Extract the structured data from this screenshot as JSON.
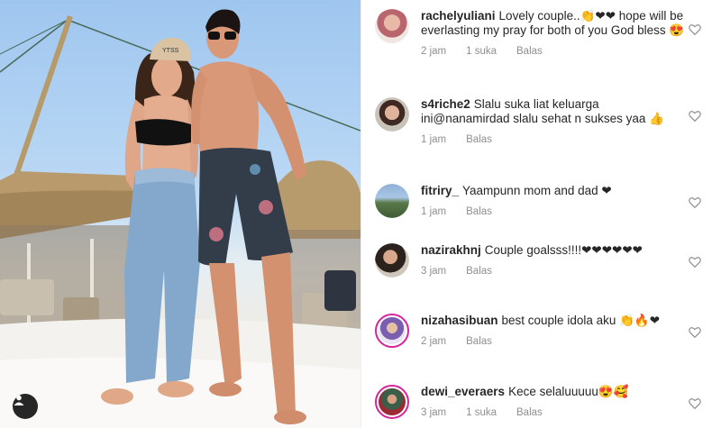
{
  "post": {
    "cap_text": "YTSS"
  },
  "comments": [
    {
      "username": "rachelyuliani",
      "text": "Lovely couple..👏❤❤ hope will be everlasting  my pray for both of you  God bless 😍",
      "time": "2 jam",
      "likes": "1 suka",
      "reply": "Balas"
    },
    {
      "username": "s4riche2",
      "text": "Slalu suka liat keluarga ini@nanamirdad slalu sehat n sukses yaa 👍",
      "time": "1 jam",
      "likes": "",
      "reply": "Balas"
    },
    {
      "username": "fitriry_",
      "text": "Yaampunn mom and dad ❤",
      "time": "1 jam",
      "likes": "",
      "reply": "Balas"
    },
    {
      "username": "nazirakhnj",
      "text": "Couple goalsss!!!!❤❤❤❤❤❤",
      "time": "3 jam",
      "likes": "",
      "reply": "Balas"
    },
    {
      "username": "nizahasibuan",
      "text": "best couple idola aku 👏🔥❤",
      "time": "2 jam",
      "likes": "",
      "reply": "Balas"
    },
    {
      "username": "dewi_everaers",
      "text": "Kece selaluuuuu😍🥰",
      "time": "3 jam",
      "likes": "1 suka",
      "reply": "Balas"
    }
  ],
  "icons": {
    "like": "heart-outline-icon",
    "user_tag": "user-tag-icon"
  },
  "colors": {
    "username": "#262626",
    "meta": "#8e8e8e",
    "heart": "#ed1c24",
    "story_ring": "#d6249f"
  }
}
